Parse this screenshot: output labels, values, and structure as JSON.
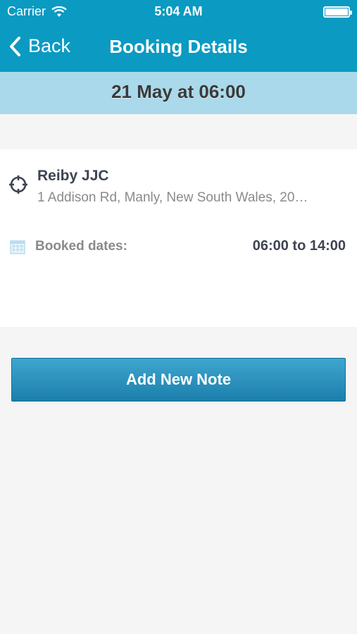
{
  "status_bar": {
    "carrier": "Carrier",
    "time": "5:04 AM"
  },
  "nav": {
    "back_label": "Back",
    "title": "Booking Details"
  },
  "date_banner": {
    "text": "21 May at 06:00"
  },
  "location": {
    "name": "Reiby JJC",
    "address": "1 Addison Rd, Manly, New South Wales, 20…"
  },
  "booking": {
    "label": "Booked dates:",
    "value": "06:00 to 14:00"
  },
  "actions": {
    "add_note_label": "Add New Note"
  },
  "colors": {
    "nav_bg": "#0a9ac2",
    "date_band_bg": "#a9d9ea",
    "button_bg": "#2a8fbd"
  },
  "icons": [
    "back-chevron-icon",
    "wifi-icon",
    "battery-icon",
    "location-target-icon",
    "calendar-icon"
  ]
}
